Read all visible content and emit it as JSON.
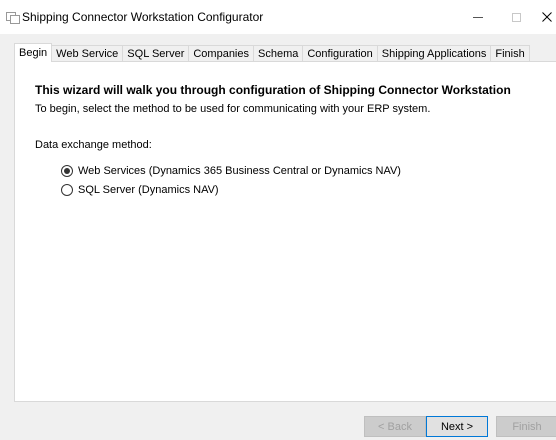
{
  "window": {
    "title": "Shipping Connector Workstation Configurator",
    "controls": {
      "minimize": "—",
      "maximize": "□",
      "close": "✕"
    }
  },
  "tabs": [
    {
      "label": "Begin",
      "active": true
    },
    {
      "label": "Web Service"
    },
    {
      "label": "SQL Server"
    },
    {
      "label": "Companies"
    },
    {
      "label": "Schema"
    },
    {
      "label": "Configuration"
    },
    {
      "label": "Shipping Applications"
    },
    {
      "label": "Finish"
    }
  ],
  "begin": {
    "heading": "This wizard will walk you through configuration of Shipping Connector Workstation",
    "intro": "To begin, select the method to be used for communicating with your ERP system.",
    "group_label": "Data exchange method:",
    "options": [
      {
        "label": "Web Services (Dynamics 365 Business Central or Dynamics NAV)",
        "selected": true
      },
      {
        "label": "SQL Server (Dynamics NAV)",
        "selected": false
      }
    ]
  },
  "buttons": {
    "back": "< Back",
    "next": "Next >",
    "finish": "Finish"
  },
  "icons": {
    "app": "app-window-icon"
  }
}
